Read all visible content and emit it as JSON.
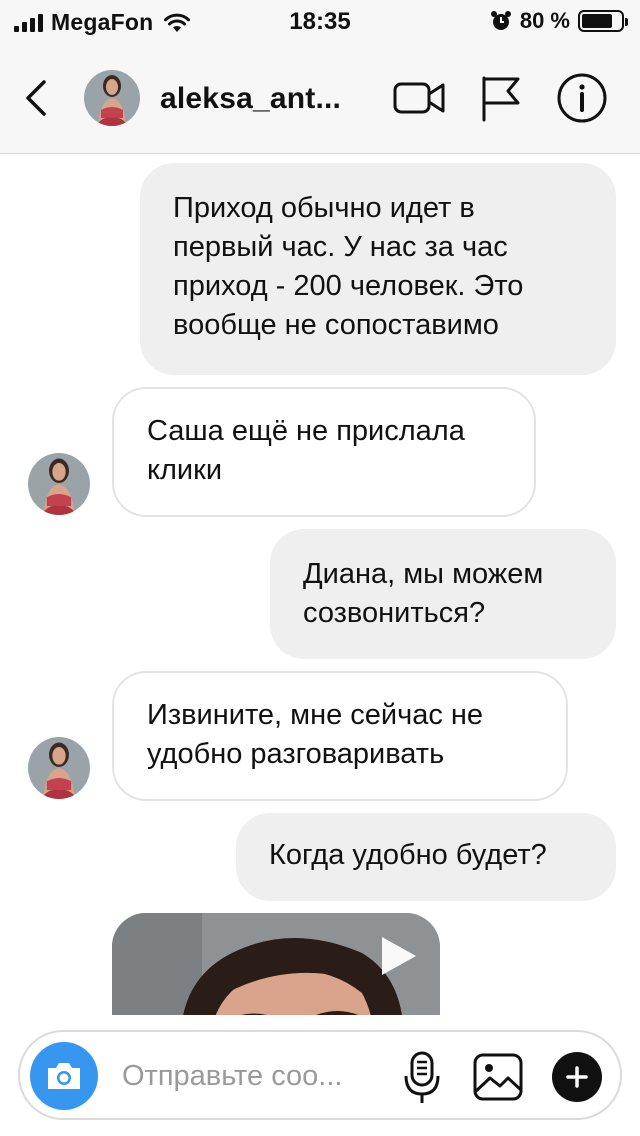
{
  "status_bar": {
    "carrier": "MegaFon",
    "time": "18:35",
    "battery_percent": "80 %",
    "battery_level": 0.8
  },
  "header": {
    "username": "aleksa_ant...",
    "icons": [
      "chevron-left-icon",
      "video-camera-icon",
      "flag-icon",
      "info-icon"
    ]
  },
  "messages": [
    {
      "direction": "outgoing",
      "lines": [
        "Приход обычно идет в",
        "первый час. У нас за час",
        "приход - 200 человек. Это",
        "вообще не сопоставимо"
      ]
    },
    {
      "direction": "incoming",
      "lines": [
        "Саша ещё не прислала",
        "клики"
      ]
    },
    {
      "direction": "outgoing",
      "lines": [
        "Диана, мы можем",
        "созвониться?"
      ]
    },
    {
      "direction": "incoming",
      "lines": [
        "Извините, мне сейчас не",
        "удобно разговаривать"
      ]
    },
    {
      "direction": "outgoing",
      "lines": [
        "Когда удобно будет?"
      ]
    },
    {
      "direction": "incoming",
      "type": "video"
    }
  ],
  "composer": {
    "placeholder": "Отправьте соо...",
    "icons": [
      "camera-icon",
      "microphone-icon",
      "gallery-icon",
      "plus-icon"
    ]
  },
  "colors": {
    "accent": "#3797f0",
    "outgoing_bubble": "#efefef",
    "incoming_border": "#e3e3e3",
    "bar_background": "#f7f7f7"
  }
}
